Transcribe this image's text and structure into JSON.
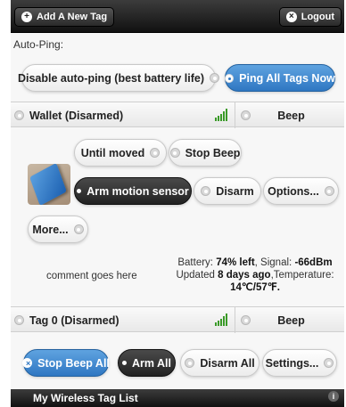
{
  "header": {
    "add_tag_label": "Add A New Tag",
    "add_tag_icon": "+",
    "logout_label": "Logout",
    "logout_icon": "×"
  },
  "autoping": {
    "label": "Auto-Ping:",
    "disable_label": "Disable auto-ping (best battery life)",
    "ping_all_label": "Ping All Tags Now"
  },
  "tags": [
    {
      "name": "Wallet (Disarmed)",
      "beep_label": "Beep",
      "actions": {
        "until_moved": "Until moved",
        "stop_beep": "Stop Beep",
        "arm_motion": "Arm motion sensor",
        "disarm": "Disarm",
        "options": "Options...",
        "more": "More..."
      },
      "comment": "comment goes here",
      "info": {
        "battery_prefix": "Battery:",
        "battery_value": "74% left",
        "signal_prefix": ", Signal:",
        "signal_value": "-66dBm",
        "updated_prefix": "Updated",
        "updated_value": "8 days ago",
        "temp_prefix": ",Temperature:",
        "temp_value": "14℃/57℉."
      }
    },
    {
      "name": "Tag 0 (Disarmed)",
      "beep_label": "Beep"
    }
  ],
  "bulk": {
    "stop_beep_all": "Stop Beep All",
    "arm_all": "Arm All",
    "disarm_all": "Disarm All",
    "settings": "Settings..."
  },
  "footer": {
    "title": "My Wireless Tag List",
    "info_icon": "i"
  },
  "colors": {
    "accent_blue": "#2f77c2",
    "signal_green": "#3a9a28",
    "bar_dark": "#111111"
  }
}
